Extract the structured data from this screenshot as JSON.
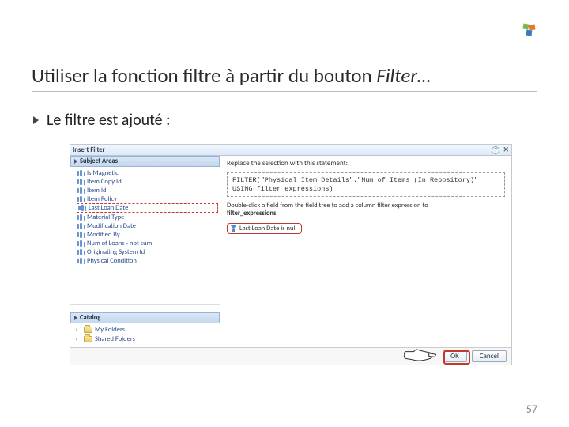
{
  "slide": {
    "title_prefix": "Utiliser la fonction filtre à partir du bouton ",
    "title_italic": "Filter…",
    "bullet": "Le filtre est ajouté :",
    "page_number": "57"
  },
  "dialog": {
    "title": "Insert Filter",
    "help_symbol": "?",
    "close_symbol": "✕",
    "sections": {
      "subject_areas": "Subject Areas",
      "catalog": "Catalog"
    },
    "tree_items": [
      "Is Magnetic",
      "Item Copy Id",
      "Item Id",
      "Item Policy",
      "Last Loan Date",
      "Material Type",
      "Modification Date",
      "Modified By",
      "Num of Loans - not sum",
      "Originating System Id",
      "Physical Condition"
    ],
    "tree_selected_index": 4,
    "catalog_items": [
      "My Folders",
      "Shared Folders"
    ],
    "replace_label": "Replace the selection with this statement:",
    "expression": "FILTER(\"Physical Item Details\".\"Num of Items (In Repository)\" USING filter_expressions)",
    "instruction_line1": "Double-click a field from the field tree to add a column filter expression to",
    "instruction_line2": "filter_expressions.",
    "chip_text": "Last Loan Date is null",
    "buttons": {
      "ok": "OK",
      "cancel": "Cancel"
    }
  }
}
